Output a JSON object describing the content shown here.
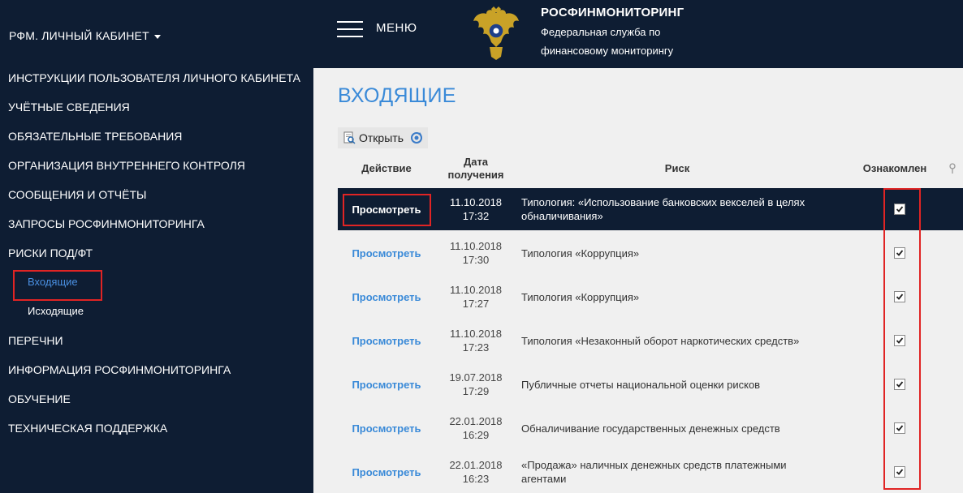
{
  "sidebar": {
    "brand": "РФМ. ЛИЧНЫЙ КАБИНЕТ",
    "items": [
      {
        "label": "ИНСТРУКЦИИ ПОЛЬЗОВАТЕЛЯ ЛИЧНОГО КАБИНЕТА"
      },
      {
        "label": "УЧЁТНЫЕ СВЕДЕНИЯ"
      },
      {
        "label": "ОБЯЗАТЕЛЬНЫЕ ТРЕБОВАНИЯ"
      },
      {
        "label": "ОРГАНИЗАЦИЯ ВНУТРЕННЕГО КОНТРОЛЯ"
      },
      {
        "label": "СООБЩЕНИЯ И ОТЧЁТЫ"
      },
      {
        "label": "ЗАПРОСЫ РОСФИНМОНИТОРИНГА"
      },
      {
        "label": "РИСКИ ПОД/ФТ"
      },
      {
        "label": "Входящие"
      },
      {
        "label": "Исходящие"
      },
      {
        "label": "ПЕРЕЧНИ"
      },
      {
        "label": "ИНФОРМАЦИЯ РОСФИНМОНИТОРИНГА"
      },
      {
        "label": "ОБУЧЕНИЕ"
      },
      {
        "label": "ТЕХНИЧЕСКАЯ ПОДДЕРЖКА"
      }
    ]
  },
  "header": {
    "menu_label": "МЕНЮ",
    "org_title": "РОСФИНМОНИТОРИНГ",
    "org_sub1": "Федеральная служба по",
    "org_sub2": "финансовому мониторингу"
  },
  "main": {
    "title": "ВХОДЯЩИЕ",
    "toolbar": {
      "open_label": "Открыть"
    },
    "columns": {
      "action": "Действие",
      "date_line1": "Дата",
      "date_line2": "получения",
      "risk": "Риск",
      "ack": "Ознакомлен"
    },
    "rows": [
      {
        "action": "Просмотреть",
        "date": "11.10.2018",
        "time": "17:32",
        "risk_line1": "Типология: «Использование банковских векселей в целях",
        "risk_line2": "обналичивания»",
        "ack": true
      },
      {
        "action": "Просмотреть",
        "date": "11.10.2018",
        "time": "17:30",
        "risk_line1": "Типология «Коррупция»",
        "risk_line2": "",
        "ack": true
      },
      {
        "action": "Просмотреть",
        "date": "11.10.2018",
        "time": "17:27",
        "risk_line1": "Типология «Коррупция»",
        "risk_line2": "",
        "ack": true
      },
      {
        "action": "Просмотреть",
        "date": "11.10.2018",
        "time": "17:23",
        "risk_line1": "Типология «Незаконный оборот наркотических средств»",
        "risk_line2": "",
        "ack": true
      },
      {
        "action": "Просмотреть",
        "date": "19.07.2018",
        "time": "17:29",
        "risk_line1": "Публичные отчеты национальной оценки рисков",
        "risk_line2": "",
        "ack": true
      },
      {
        "action": "Просмотреть",
        "date": "22.01.2018",
        "time": "16:29",
        "risk_line1": "Обналичивание государственных денежных средств",
        "risk_line2": "",
        "ack": true
      },
      {
        "action": "Просмотреть",
        "date": "22.01.2018",
        "time": "16:23",
        "risk_line1": "«Продажа» наличных денежных средств платежными",
        "risk_line2": "агентами",
        "ack": true
      }
    ]
  },
  "colors": {
    "navy": "#0e1d33",
    "accent_blue": "#3a8ad8",
    "highlight_red": "#e02424"
  }
}
